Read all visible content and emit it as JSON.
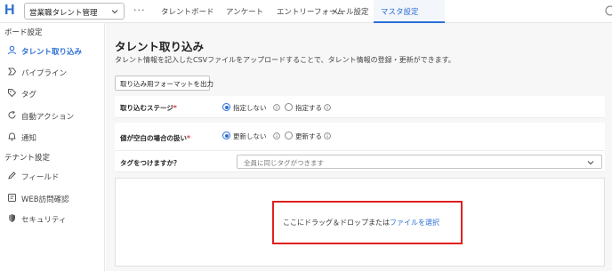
{
  "header": {
    "logo_letter": "H",
    "workspace": "営業職タレント管理",
    "more": "···",
    "tabs": [
      {
        "label": "タレントボード"
      },
      {
        "label": "アンケート"
      },
      {
        "label": "エントリーフォーム"
      },
      {
        "label": "メール設定"
      },
      {
        "label": "マスタ設定",
        "active": true
      }
    ]
  },
  "sidebar": {
    "section1": "ボード設定",
    "items1": [
      {
        "label": "タレント取り込み",
        "icon": "person-icon",
        "active": true
      },
      {
        "label": "パイプライン",
        "icon": "pipeline-icon"
      },
      {
        "label": "タグ",
        "icon": "tag-icon"
      },
      {
        "label": "自動アクション",
        "icon": "refresh-icon"
      },
      {
        "label": "通知",
        "icon": "bell-icon"
      }
    ],
    "section2": "テナント設定",
    "items2": [
      {
        "label": "フィールド",
        "icon": "pencil-icon"
      },
      {
        "label": "WEB訪問確認",
        "icon": "web-visit-icon"
      },
      {
        "label": "セキュリティ",
        "icon": "shield-icon"
      }
    ]
  },
  "main": {
    "title": "タレント取り込み",
    "description": "タレント情報を記入したCSVファイルをアップロードすることで、タレント情報の登録・更新ができます。",
    "export_button": "取り込み用フォーマットを出力",
    "stage_row": {
      "label": "取り込むステージ",
      "required_mark": "*",
      "option1": "指定しない",
      "option2": "指定する",
      "selected": "指定しない"
    },
    "empty_row": {
      "label": "値が空白の場合の扱い",
      "required_mark": "*",
      "option1": "更新しない",
      "option2": "更新する",
      "selected": "更新しない"
    },
    "tag_row": {
      "label": "タグをつけますか？",
      "placeholder": "全員に同じタグがつきます"
    },
    "dropzone": {
      "text": "ここにドラッグ＆ドロップまたは",
      "link": "ファイルを選択"
    }
  },
  "colors": {
    "accent": "#2b6fd6",
    "highlight": "#e02020",
    "required": "#d9363e"
  }
}
